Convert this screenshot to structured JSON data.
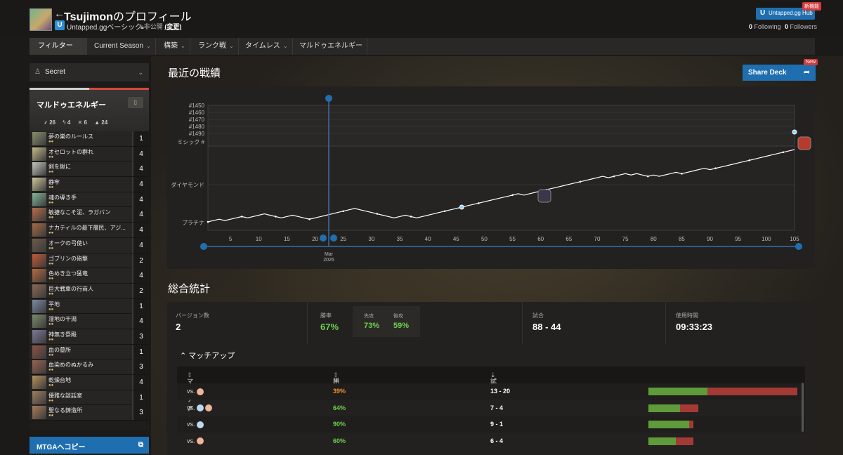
{
  "header": {
    "title_name": "Tsujimon",
    "title_suffix": "のプロフィール",
    "subscription": "Untapped.ggベーシック",
    "privacy": "非公開",
    "privacy_change": "(変更)",
    "hub_button": "Untapped.gg Hub",
    "hub_badge": "新機能",
    "following_count": "0",
    "following_label": "Following",
    "followers_count": "0",
    "followers_label": "Followers"
  },
  "filters": {
    "filter_label": "フィルター",
    "items": [
      "Current Season",
      "構築",
      "ランク戦",
      "タイムレス",
      "マルドゥエネルギー"
    ]
  },
  "deck": {
    "selector": "Secret",
    "name": "マルドゥエネルギー",
    "stats": [
      "26",
      "4",
      "6",
      "24"
    ],
    "cards": [
      {
        "name": "夢の巣のルールス",
        "count": "1",
        "color": "#8a8f6e"
      },
      {
        "name": "オセロットの群れ",
        "count": "4",
        "color": "#c7b98a"
      },
      {
        "name": "剣を鍬に",
        "count": "4",
        "color": "#c3c6bf"
      },
      {
        "name": "静牢",
        "count": "4",
        "color": "#d0c79a"
      },
      {
        "name": "魂の導き手",
        "count": "4",
        "color": "#84b49a"
      },
      {
        "name": "敏捷なこそ泥、ラガバン",
        "count": "4",
        "color": "#b86d4d"
      },
      {
        "name": "ナカティルの最下層民、アジ...",
        "count": "4",
        "color": "#a66a47"
      },
      {
        "name": "オークの弓使い",
        "count": "4",
        "color": "#6d5b4a"
      },
      {
        "name": "ゴブリンの砲撃",
        "count": "2",
        "color": "#c25b37"
      },
      {
        "name": "色めき立つ猛竜",
        "count": "4",
        "color": "#b86a3e"
      },
      {
        "name": "巨大戦車の行商人",
        "count": "2",
        "color": "#8b6a55"
      },
      {
        "name": "平地",
        "count": "1",
        "color": "#7b8aa3"
      },
      {
        "name": "湿地の干潟",
        "count": "4",
        "color": "#7c8b6b"
      },
      {
        "name": "神無き祭殿",
        "count": "3",
        "color": "#7d7a9a"
      },
      {
        "name": "血の墓所",
        "count": "1",
        "color": "#8a5447"
      },
      {
        "name": "血染めのぬかるみ",
        "count": "3",
        "color": "#9a6451"
      },
      {
        "name": "乾燥台地",
        "count": "4",
        "color": "#b6925c"
      },
      {
        "name": "優雅な談話室",
        "count": "1",
        "color": "#9c7f63"
      },
      {
        "name": "聖なる鋳造所",
        "count": "3",
        "color": "#a87a5a"
      }
    ],
    "copy_button": "MTGAへコピー"
  },
  "recent": {
    "title": "最近の戦績",
    "share_button": "Share Deck",
    "share_badge": "New"
  },
  "chart_data": {
    "type": "line",
    "title": "",
    "x": [
      1,
      2,
      3,
      4,
      5,
      6,
      7,
      8,
      9,
      10,
      11,
      12,
      13,
      14,
      15,
      16,
      17,
      18,
      19,
      20,
      21,
      22,
      23,
      24,
      25,
      26,
      27,
      28,
      29,
      30,
      31,
      32,
      33,
      34,
      35,
      36,
      37,
      38,
      39,
      40,
      41,
      42,
      43,
      44,
      45,
      46,
      47,
      48,
      49,
      50,
      51,
      52,
      53,
      54,
      55,
      56,
      57,
      58,
      59,
      60,
      61,
      62,
      63,
      64,
      65,
      66,
      67,
      68,
      69,
      70,
      71,
      72,
      73,
      74,
      75,
      76,
      77,
      78,
      79,
      80,
      81,
      82,
      83,
      84,
      85,
      86,
      87,
      88,
      89,
      90,
      91,
      92,
      93,
      94,
      95,
      96,
      97,
      98,
      99,
      100,
      101,
      102,
      103,
      104,
      105
    ],
    "y": [
      1,
      2,
      3,
      2,
      3,
      4,
      5,
      4,
      5,
      6,
      7,
      6,
      5,
      4,
      5,
      6,
      5,
      4,
      3,
      4,
      5,
      6,
      7,
      8,
      9,
      10,
      11,
      10,
      9,
      8,
      7,
      6,
      5,
      4,
      5,
      6,
      5,
      4,
      5,
      6,
      7,
      8,
      9,
      10,
      11,
      12,
      13,
      14,
      15,
      16,
      17,
      18,
      19,
      20,
      21,
      22,
      21,
      22,
      23,
      24,
      25,
      26,
      27,
      28,
      29,
      30,
      31,
      32,
      33,
      34,
      35,
      34,
      35,
      36,
      37,
      36,
      37,
      36,
      35,
      36,
      35,
      36,
      37,
      38,
      37,
      38,
      39,
      40,
      41,
      40,
      41,
      42,
      43,
      44,
      45,
      46,
      47,
      48,
      49,
      50,
      51,
      52,
      53,
      54,
      55
    ],
    "ylabels": [
      "#1450",
      "#1460",
      "#1470",
      "#1480",
      "#1490",
      "ミシック #",
      "ダイヤモンド",
      "プラチナ"
    ],
    "xticks": [
      "5",
      "10",
      "15",
      "20",
      "25",
      "30",
      "35",
      "40",
      "45",
      "50",
      "55",
      "60",
      "65",
      "70",
      "75",
      "80",
      "85",
      "90",
      "95",
      "100",
      "105"
    ],
    "date_label": "Mar",
    "date_year": "2026"
  },
  "overall": {
    "title": "総合統計",
    "versions_label": "バージョン数",
    "versions_value": "2",
    "winrate_label": "勝率",
    "winrate_value": "67%",
    "first_label": "先攻",
    "first_value": "73%",
    "second_label": "後攻",
    "second_value": "59%",
    "games_label": "試合",
    "games_value": "88 - 44",
    "time_label": "使用時間",
    "time_value": "09:33:23"
  },
  "matchups": {
    "toggle_label": "マッチアップ",
    "col_matchup": "マッチアップ",
    "col_winrate": "勝率",
    "col_games": "試合",
    "rows": [
      {
        "vs": "vs.",
        "mana": [
          "r"
        ],
        "winrate": "39%",
        "games": "13 - 20",
        "wins": 13,
        "losses": 20,
        "tone": "orange"
      },
      {
        "vs": "vs.",
        "mana": [
          "u",
          "r"
        ],
        "winrate": "64%",
        "games": "7 - 4",
        "wins": 7,
        "losses": 4,
        "tone": "green"
      },
      {
        "vs": "vs.",
        "mana": [
          "u"
        ],
        "winrate": "90%",
        "games": "9 - 1",
        "wins": 9,
        "losses": 1,
        "tone": "green"
      },
      {
        "vs": "vs.",
        "mana": [
          "r"
        ],
        "winrate": "60%",
        "games": "6 - 4",
        "wins": 6,
        "losses": 4,
        "tone": "green"
      }
    ]
  }
}
